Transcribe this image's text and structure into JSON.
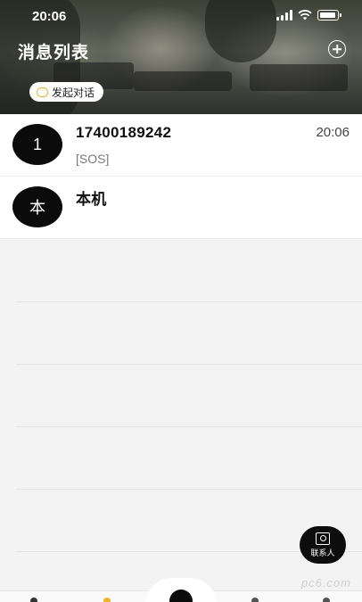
{
  "status_bar": {
    "time": "20:06"
  },
  "header": {
    "title": "消息列表",
    "start_chat_label": "发起对话"
  },
  "messages": [
    {
      "avatar": "1",
      "title": "17400189242",
      "subtitle": "[SOS]",
      "time": "20:06"
    },
    {
      "avatar": "本",
      "title": "本机",
      "subtitle": "",
      "time": ""
    }
  ],
  "contacts_button": {
    "label": "联系人"
  },
  "watermark": "pc6.com",
  "colors": {
    "accent_yellow": "#f0b429",
    "avatar_bg": "#0b0b0b"
  },
  "icons": [
    "signal-icon",
    "wifi-icon",
    "battery-icon",
    "add-circle-icon",
    "chat-bubble-icon",
    "contacts-icon"
  ]
}
